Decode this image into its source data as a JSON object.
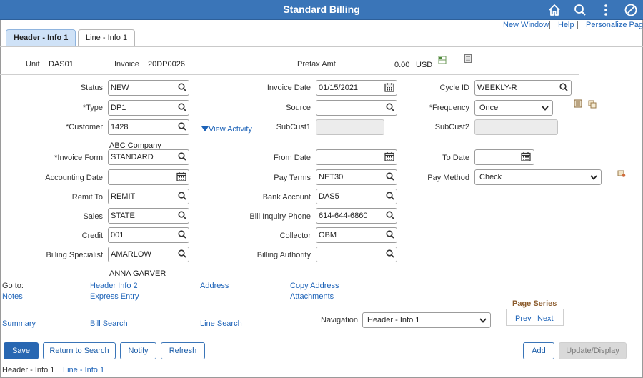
{
  "header": {
    "title": "Standard Billing",
    "icons": [
      "home-icon",
      "search-icon",
      "actions-menu-icon",
      "navbar-icon"
    ]
  },
  "toplinks": {
    "new_window": "New Window",
    "help": "Help",
    "personalize": "Personalize Page",
    "sep": "|"
  },
  "tabs": [
    {
      "label": "Header - Info 1",
      "active": true
    },
    {
      "label": "Line - Info 1",
      "active": false
    }
  ],
  "summary": {
    "unit_label": "Unit",
    "unit_value": "DAS01",
    "invoice_label": "Invoice",
    "invoice_value": "20DP0026",
    "pretax_label": "Pretax Amt",
    "pretax_value": "0.00",
    "currency": "USD"
  },
  "form": {
    "status": {
      "label": "Status",
      "value": "NEW"
    },
    "type": {
      "label": "*Type",
      "value": "DP1"
    },
    "customer": {
      "label": "*Customer",
      "value": "1428",
      "desc": "ABC Company"
    },
    "view_activity": "View Activity",
    "invoice_form": {
      "label": "*Invoice Form",
      "value": "STANDARD"
    },
    "accounting_date": {
      "label": "Accounting Date",
      "value": ""
    },
    "remit_to": {
      "label": "Remit To",
      "value": "REMIT"
    },
    "sales": {
      "label": "Sales",
      "value": "STATE"
    },
    "credit": {
      "label": "Credit",
      "value": "001"
    },
    "billing_specialist": {
      "label": "Billing Specialist",
      "value": "AMARLOW",
      "desc": "ANNA GARVER"
    },
    "invoice_date": {
      "label": "Invoice Date",
      "value": "01/15/2021"
    },
    "source": {
      "label": "Source",
      "value": ""
    },
    "subcust1": {
      "label": "SubCust1",
      "value": ""
    },
    "from_date": {
      "label": "From Date",
      "value": ""
    },
    "pay_terms": {
      "label": "Pay Terms",
      "value": "NET30"
    },
    "bank_account": {
      "label": "Bank Account",
      "value": "DAS5"
    },
    "bill_inquiry_phone": {
      "label": "Bill Inquiry Phone",
      "value": "614-644-6860"
    },
    "collector": {
      "label": "Collector",
      "value": "OBM"
    },
    "billing_authority": {
      "label": "Billing Authority",
      "value": ""
    },
    "cycle_id": {
      "label": "Cycle ID",
      "value": "WEEKLY-R"
    },
    "frequency": {
      "label": "*Frequency",
      "value": "Once"
    },
    "subcust2": {
      "label": "SubCust2",
      "value": ""
    },
    "to_date": {
      "label": "To Date",
      "value": ""
    },
    "pay_method": {
      "label": "Pay Method",
      "value": "Check"
    }
  },
  "goto": {
    "label": "Go to:",
    "links": {
      "header_info2": "Header Info 2",
      "address": "Address",
      "copy_address": "Copy Address",
      "notes": "Notes",
      "express_entry": "Express Entry",
      "attachments": "Attachments",
      "summary": "Summary",
      "bill_search": "Bill Search",
      "line_search": "Line Search"
    }
  },
  "navigation": {
    "label": "Navigation",
    "value": "Header - Info 1"
  },
  "page_series": {
    "label": "Page Series",
    "prev": "Prev",
    "next": "Next"
  },
  "buttons": {
    "save": "Save",
    "return_to_search": "Return to Search",
    "notify": "Notify",
    "refresh": "Refresh",
    "add": "Add",
    "update_display": "Update/Display"
  },
  "footer": {
    "current": "Header - Info 1",
    "sep": "|",
    "next_link": "Line - Info 1"
  },
  "colors": {
    "titlebar": "#3a75b8",
    "link": "#1d63b8",
    "primary_button": "#2867b2",
    "page_series": "#8a5a2b"
  }
}
